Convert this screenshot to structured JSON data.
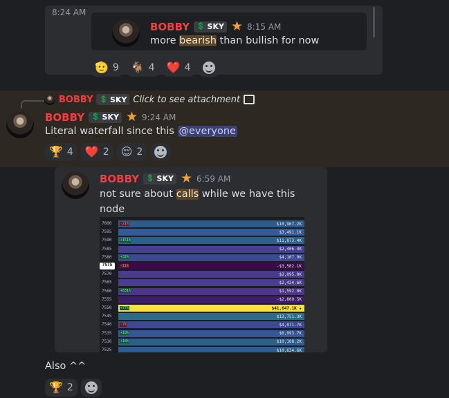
{
  "top_card": {
    "time": "8:24 AM",
    "embed": {
      "author": "BOBBY",
      "tag": "SKY",
      "time": "8:15 AM",
      "text_before": "more ",
      "text_highlight": "bearish",
      "text_after": " than bullish for now"
    },
    "reactions": [
      {
        "emoji": "🫡",
        "count": "9"
      },
      {
        "emoji": "🐐",
        "count": "4"
      },
      {
        "emoji": "❤️",
        "count": "4"
      }
    ]
  },
  "highlighted_message": {
    "reply": {
      "author": "BOBBY",
      "tag": "SKY",
      "text": "Click to see attachment"
    },
    "author": "BOBBY",
    "tag": "SKY",
    "time": "9:24 AM",
    "text": "Literal waterfall since this ",
    "mention": "@everyone",
    "reactions": [
      {
        "emoji": "🏆",
        "count": "4"
      },
      {
        "emoji": "❤️",
        "count": "2"
      },
      {
        "emoji": "😌",
        "count": "2"
      }
    ]
  },
  "embed2": {
    "author": "BOBBY",
    "tag": "SKY",
    "time": "6:59 AM",
    "text_before": "not sure about ",
    "text_highlight": "calls",
    "text_after": " while we have this node",
    "chart_rows": [
      {
        "price": "7600",
        "pct": "-21%",
        "pct_sign": "neg",
        "value": "$10,967.2K",
        "color": "#2d5c8c"
      },
      {
        "price": "7595",
        "pct": "",
        "pct_sign": "",
        "value": "$3,491.1K",
        "color": "#355a96"
      },
      {
        "price": "7590",
        "pct": "+151%",
        "pct_sign": "pos",
        "value": "$11,873.4K",
        "color": "#2c618c"
      },
      {
        "price": "7585",
        "pct": "",
        "pct_sign": "",
        "value": "$2,406.4K",
        "color": "#44428e"
      },
      {
        "price": "7580",
        "pct": "+32%",
        "pct_sign": "pos",
        "value": "$4,107.9K",
        "color": "#3d4a92"
      },
      {
        "price": "7575",
        "pct": "-11%",
        "pct_sign": "neg",
        "value": "-$3,582.1K",
        "color": "#3a0b45",
        "current": true
      },
      {
        "price": "7570",
        "pct": "",
        "pct_sign": "",
        "value": "$2,095.0K",
        "color": "#4b3b8c"
      },
      {
        "price": "7565",
        "pct": "",
        "pct_sign": "",
        "value": "$2,424.6K",
        "color": "#4a3d8d"
      },
      {
        "price": "7560",
        "pct": "+831%",
        "pct_sign": "pos",
        "value": "$1,592.0K",
        "color": "#4c358a"
      },
      {
        "price": "7555",
        "pct": "",
        "pct_sign": "",
        "value": "-$2,809.5K",
        "color": "#3e1d6a"
      },
      {
        "price": "7550",
        "pct": "+77%",
        "pct_sign": "pos",
        "value": "$41,647.1K",
        "color": "#f7e23a",
        "max": true
      },
      {
        "price": "7545",
        "pct": "",
        "pct_sign": "",
        "value": "$13,751.3K",
        "color": "#2e6b8a"
      },
      {
        "price": "7540",
        "pct": "-7%",
        "pct_sign": "neg",
        "value": "$4,071.7K",
        "color": "#3c4a92"
      },
      {
        "price": "7535",
        "pct": "+18%",
        "pct_sign": "pos",
        "value": "$6,993.7K",
        "color": "#345796"
      },
      {
        "price": "7530",
        "pct": "+18%",
        "pct_sign": "pos",
        "value": "$10,108.2K",
        "color": "#2e5e8e"
      },
      {
        "price": "7525",
        "pct": "",
        "pct_sign": "",
        "value": "$10,634.6K",
        "color": "#2e5e8e"
      }
    ]
  },
  "last_message": {
    "text": "Also ^^",
    "reactions": [
      {
        "emoji": "🏆",
        "count": "2"
      }
    ]
  }
}
